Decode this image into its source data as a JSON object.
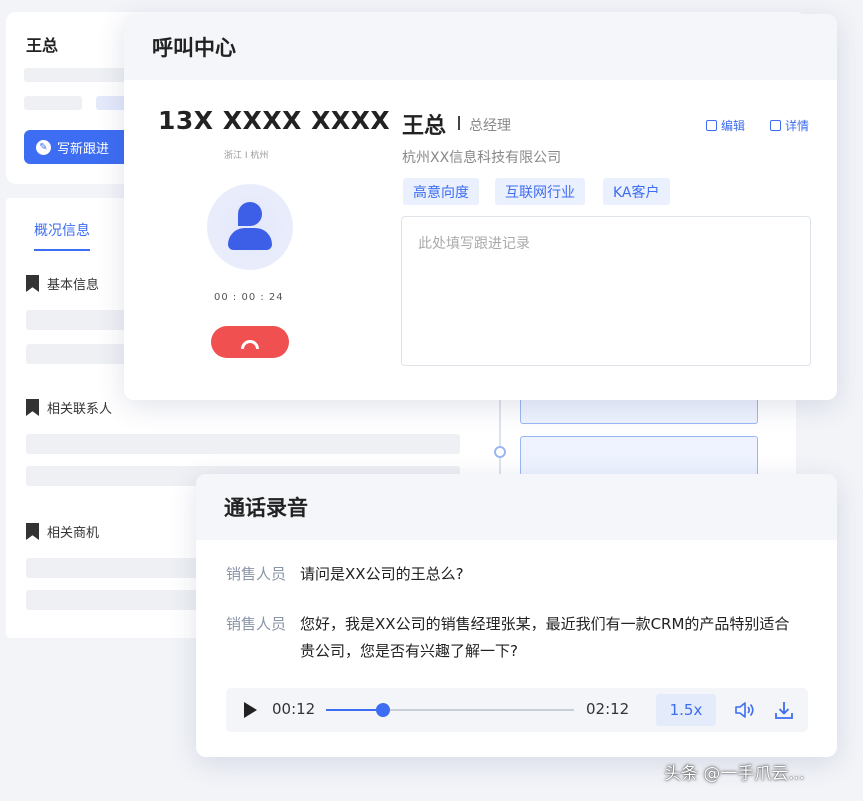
{
  "crm": {
    "contact_name": "王总",
    "write_followup_label": "写新跟进",
    "tab_overview": "概况信息",
    "sections": [
      "基本信息",
      "相关联系人",
      "相关商机"
    ]
  },
  "call_center": {
    "title": "呼叫中心",
    "phone": "13X XXXX XXXX",
    "region": "浙江 I 杭州",
    "timer": "00 : 00 : 24",
    "customer_name": "王总",
    "customer_title": "总经理",
    "company": "杭州XX信息科技有限公司",
    "edit_label": "编辑",
    "detail_label": "详情",
    "tags": [
      "高意向度",
      "互联网行业",
      "KA客户"
    ],
    "note_placeholder": "此处填写跟进记录"
  },
  "recording": {
    "title": "通话录音",
    "messages": [
      {
        "speaker": "销售人员",
        "text": "请问是XX公司的王总么?"
      },
      {
        "speaker": "销售人员",
        "text": "您好，我是XX公司的销售经理张某，最近我们有一款CRM的产品特别适合贵公司，您是否有兴趣了解一下?"
      }
    ],
    "player": {
      "current": "00:12",
      "total": "02:12",
      "progress": 0.23,
      "speed": "1.5x"
    }
  },
  "watermark": "头条 @一手爪云..."
}
